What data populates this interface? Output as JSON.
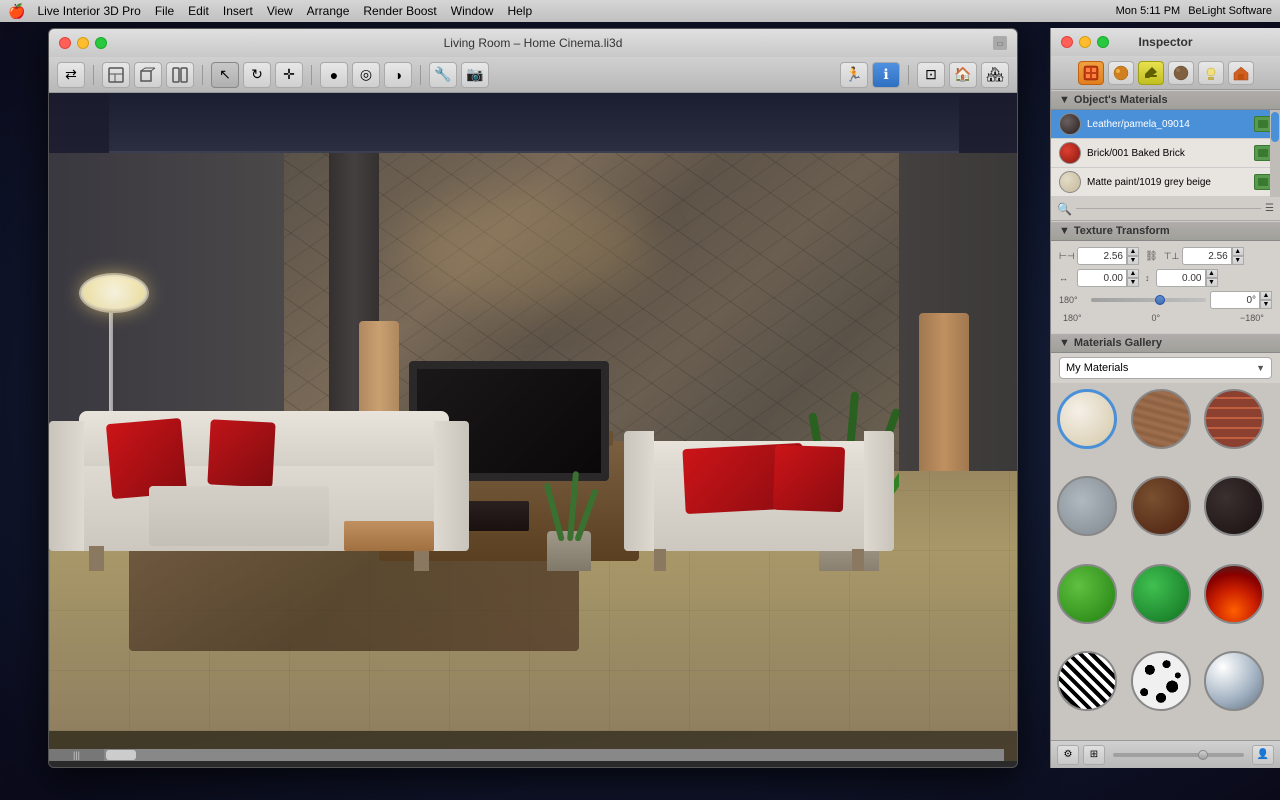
{
  "menubar": {
    "apple": "🍎",
    "items": [
      "Live Interior 3D Pro",
      "File",
      "Edit",
      "Insert",
      "View",
      "Arrange",
      "Render Boost",
      "Window",
      "Help"
    ],
    "right": {
      "time": "Mon 5:11 PM",
      "brand": "BeLight Software"
    }
  },
  "window": {
    "title": "Living Room – Home Cinema.li3d",
    "traffic_lights": [
      "close",
      "minimize",
      "maximize"
    ]
  },
  "inspector": {
    "title": "Inspector",
    "tabs": [
      "materials-tab",
      "sphere-tab",
      "pencil-tab",
      "leather-tab",
      "light-tab",
      "house-tab"
    ],
    "section_materials": "Object's Materials",
    "materials": [
      {
        "name": "Leather/pamela_09014",
        "swatch": "#4a4a4a",
        "selected": true
      },
      {
        "name": "Brick/001 Baked Brick",
        "swatch": "#cc3020"
      },
      {
        "name": "Matte paint/1019 grey beige",
        "swatch": "#d4c8a0"
      }
    ],
    "texture_transform": {
      "label": "Texture Transform",
      "width_val": "2.56",
      "height_val": "2.56",
      "offset_x": "0.00",
      "offset_y": "0.00",
      "angle": "0°",
      "angle_label_left": "180°",
      "angle_label_center": "0°",
      "angle_label_right": "−180°"
    },
    "gallery": {
      "section_label": "Materials Gallery",
      "dropdown_value": "My Materials",
      "items": [
        {
          "id": "gi-cream",
          "label": "cream"
        },
        {
          "id": "gi-wood",
          "label": "wood"
        },
        {
          "id": "gi-brick",
          "label": "brick"
        },
        {
          "id": "gi-stone",
          "label": "stone"
        },
        {
          "id": "gi-brown",
          "label": "brown leather"
        },
        {
          "id": "gi-dark",
          "label": "dark material"
        },
        {
          "id": "gi-green1",
          "label": "green 1"
        },
        {
          "id": "gi-green2",
          "label": "green 2"
        },
        {
          "id": "gi-fire",
          "label": "fire"
        },
        {
          "id": "gi-zebra",
          "label": "zebra"
        },
        {
          "id": "gi-spots",
          "label": "spots"
        },
        {
          "id": "gi-chrome",
          "label": "chrome"
        }
      ]
    }
  },
  "toolbar": {
    "buttons": [
      "←→",
      "⊞",
      "⊟",
      "⊠",
      "↖",
      "⟳",
      "⊕",
      "●",
      "◎",
      "◑",
      "🔧",
      "📷",
      "🏃",
      "ℹ",
      "⊡",
      "🏠",
      "🏘"
    ]
  },
  "scrollbar_label": "|||"
}
